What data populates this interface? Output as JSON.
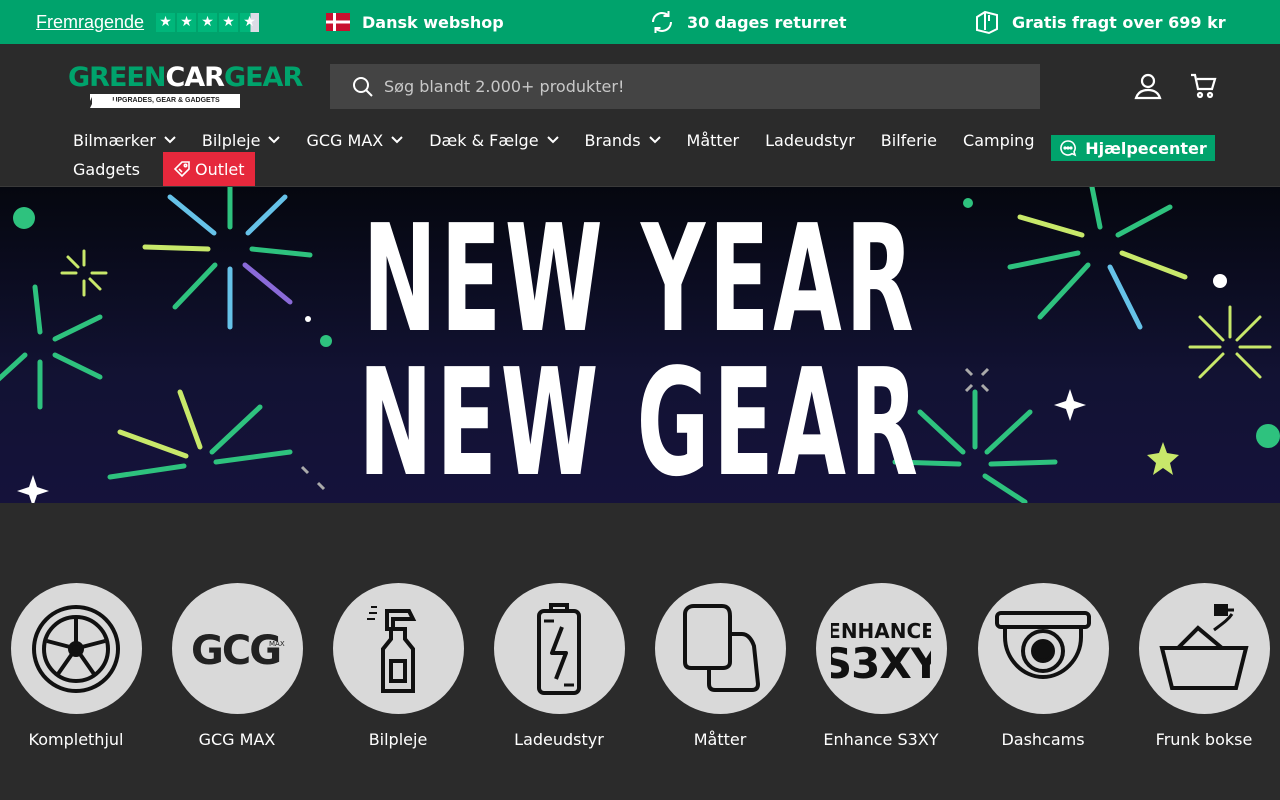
{
  "topbar": {
    "rating_text": "Fremragende",
    "stars": 4.5,
    "usps": [
      {
        "text": "Dansk webshop",
        "icon": "denmark-flag-icon"
      },
      {
        "text": "30 dages returret",
        "icon": "refresh-icon"
      },
      {
        "text": "Gratis fragt over 699 kr",
        "icon": "package-icon"
      }
    ]
  },
  "header": {
    "logo_green": "GREEN",
    "logo_white": "CAR",
    "logo_green2": "GEAR",
    "logo_tagline": "UPGRADES, GEAR & GADGETS",
    "search_placeholder": "Søg blandt 2.000+ produkter!",
    "help_label": "Hjælpecenter"
  },
  "nav": {
    "row1": [
      {
        "label": "Bilmærker",
        "dropdown": true
      },
      {
        "label": "Bilpleje",
        "dropdown": true
      },
      {
        "label": "GCG MAX",
        "dropdown": true
      },
      {
        "label": "Dæk & Fælge",
        "dropdown": true
      },
      {
        "label": "Brands",
        "dropdown": true
      },
      {
        "label": "Måtter",
        "dropdown": false
      },
      {
        "label": "Ladeudstyr",
        "dropdown": false
      },
      {
        "label": "Bilferie",
        "dropdown": false
      },
      {
        "label": "Camping",
        "dropdown": false
      }
    ],
    "row2": [
      {
        "label": "Gadgets"
      },
      {
        "label": "Outlet"
      }
    ]
  },
  "hero": {
    "line1": "NEW YEAR",
    "line2": "NEW GEAR"
  },
  "categories": [
    {
      "label": "Komplethjul",
      "icon": "wheel-icon"
    },
    {
      "label": "GCG MAX",
      "icon": "gcg-max-logo-icon"
    },
    {
      "label": "Bilpleje",
      "icon": "spray-bottle-icon"
    },
    {
      "label": "Ladeudstyr",
      "icon": "battery-icon"
    },
    {
      "label": "Måtter",
      "icon": "floor-mat-icon"
    },
    {
      "label": "Enhance S3XY",
      "icon": "enhance-s3xy-logo"
    },
    {
      "label": "Dashcams",
      "icon": "dashcam-icon"
    },
    {
      "label": "Frunk bokse",
      "icon": "frunk-box-icon"
    }
  ],
  "colors": {
    "brand_green": "#00a36c",
    "background": "#2b2b2b",
    "outlet_red": "#e6283c",
    "hero_bg": "#13113a"
  }
}
